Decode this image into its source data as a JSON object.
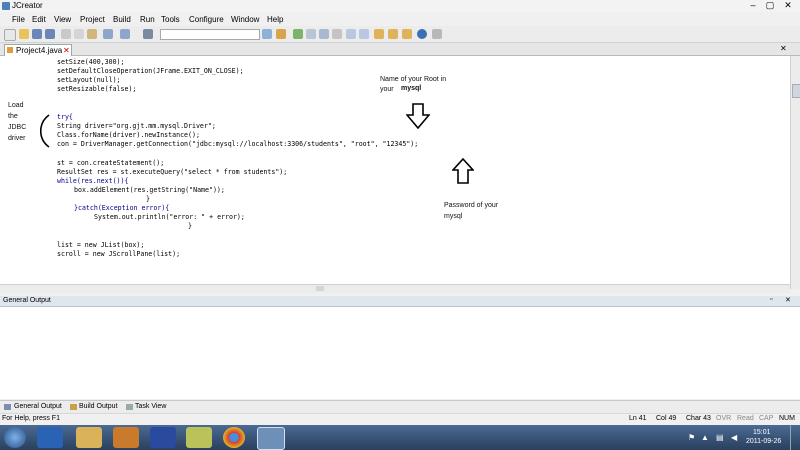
{
  "window": {
    "title": "JCreator"
  },
  "menu": [
    "File",
    "Edit",
    "View",
    "Project",
    "Build",
    "Run",
    "Tools",
    "Configure",
    "Window",
    "Help"
  ],
  "editor_tab": "Project4.java",
  "code_lines": [
    "setSize(400,300);",
    "setDefaultCloseOperation(JFrame.EXIT_ON_CLOSE);",
    "setLayout(null);",
    "setResizable(false);",
    "try{",
    "String driver=\"org.gjt.mm.mysql.Driver\";",
    "Class.forName(driver).newInstance();",
    "con = DriverManager.getConnection(\"jdbc:mysql://localhost:3306/students\", \"root\", \"12345\");",
    "st = con.createStatement();",
    "ResultSet res = st.executeQuery(\"select * from students\");",
    "while(res.next()){",
    "box.addElement(res.getString(\"Name\"));",
    "}",
    "}catch(Exception error){",
    "System.out.println(\"error: \" + error);",
    "}",
    "list = new JList(box);",
    "scroll = new JScrollPane(list);"
  ],
  "annotations": {
    "load_left": [
      "Load",
      "the",
      "JDBC",
      "driver"
    ],
    "root_line1": "Name of your Root in",
    "root_line2": "your",
    "root_bold": "mysql",
    "password_line1": "Password of your",
    "password_line2": "mysql"
  },
  "output_panel": {
    "title": "General Output"
  },
  "output_tabs": [
    "General Output",
    "Build Output",
    "Task View"
  ],
  "status": {
    "help": "For Help, press F1",
    "line": "Ln 41",
    "col": "Col 49",
    "char": "Char 43",
    "ovr": "OVR",
    "read": "Read",
    "cap": "CAP",
    "num": "NUM"
  },
  "clock": {
    "time": "15:01",
    "date": "2011-09-26"
  },
  "colors": {
    "taskbar": "#2a3f5c",
    "editor_bg": "#ffffff",
    "keyword": "#00008b"
  }
}
